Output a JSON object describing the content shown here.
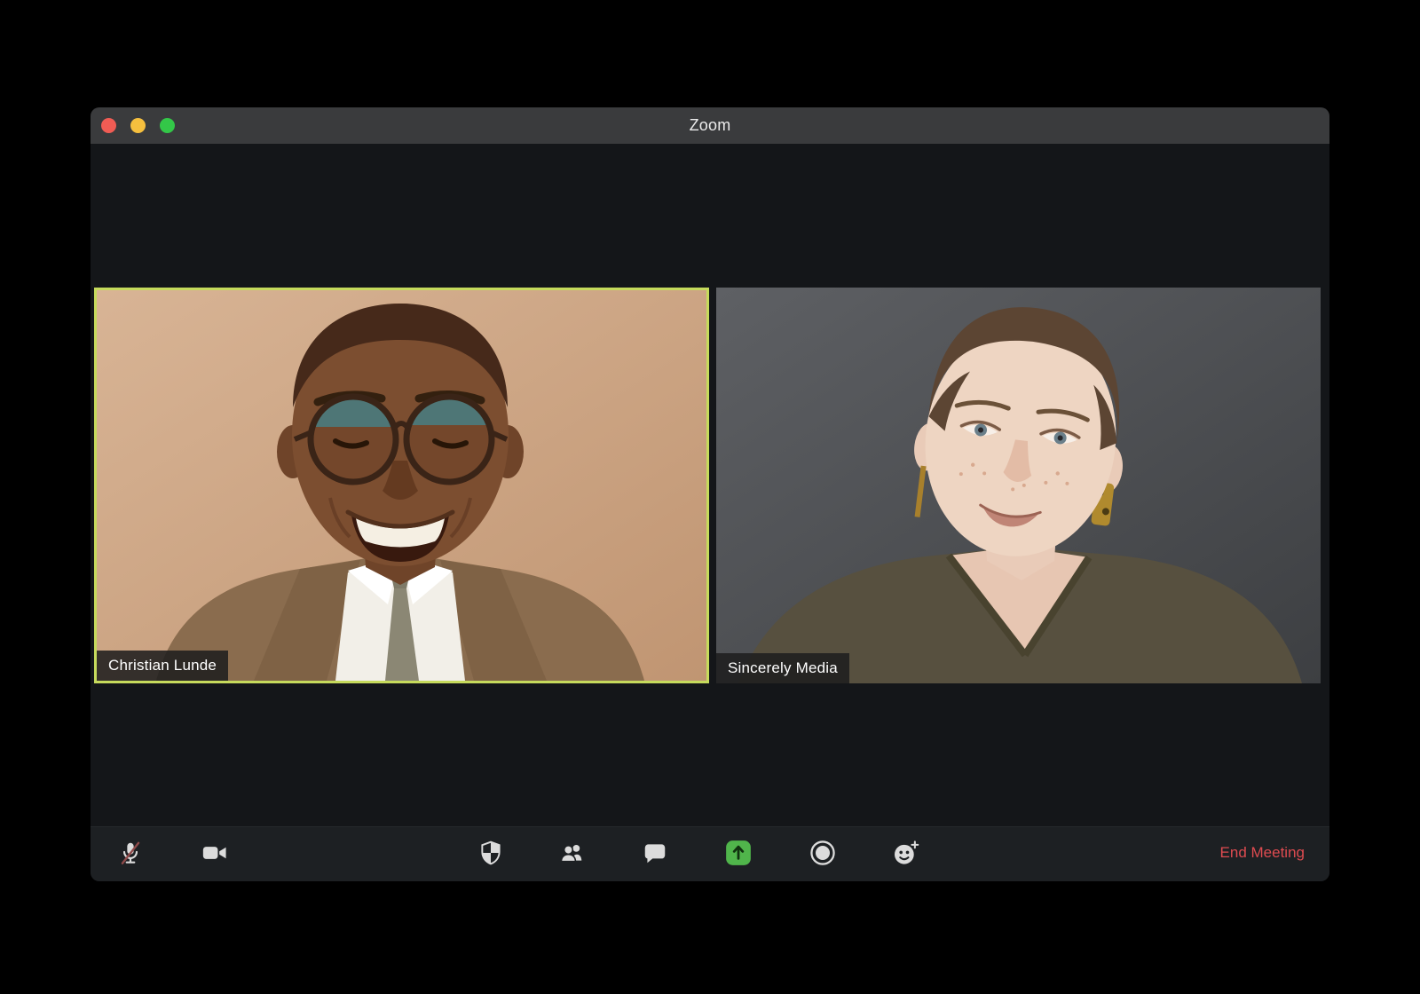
{
  "window": {
    "title": "Zoom",
    "traffic_lights": [
      "close",
      "minimize",
      "zoom"
    ]
  },
  "participants": [
    {
      "name": "Christian Lunde",
      "active_speaker": true,
      "video_bg": "#c9a587"
    },
    {
      "name": "Sincerely Media",
      "active_speaker": false,
      "video_bg": "#4a4c4e"
    }
  ],
  "toolbar": {
    "buttons": [
      {
        "id": "mute",
        "icon": "microphone-muted-icon",
        "state": "muted"
      },
      {
        "id": "video",
        "icon": "video-camera-icon"
      },
      {
        "id": "security",
        "icon": "security-shield-icon"
      },
      {
        "id": "participants",
        "icon": "participants-icon"
      },
      {
        "id": "chat",
        "icon": "chat-bubble-icon"
      },
      {
        "id": "share-screen",
        "icon": "share-screen-icon",
        "accent": "#50b54b"
      },
      {
        "id": "record",
        "icon": "record-icon"
      },
      {
        "id": "reactions",
        "icon": "reactions-icon"
      }
    ],
    "end_meeting": {
      "label": "End Meeting",
      "color": "#de4b50"
    }
  },
  "colors": {
    "titlebar": "#3a3b3d",
    "window_bg": "#141619",
    "toolbar_bg": "#1d2023",
    "active_speaker_border": "#c6da5c",
    "mute_slash": "#8f4a4a",
    "traffic_red": "#f05c54",
    "traffic_yellow": "#f5bf3e",
    "traffic_green": "#33c748",
    "end_meeting_red": "#de4b50",
    "share_green": "#50b54b"
  }
}
